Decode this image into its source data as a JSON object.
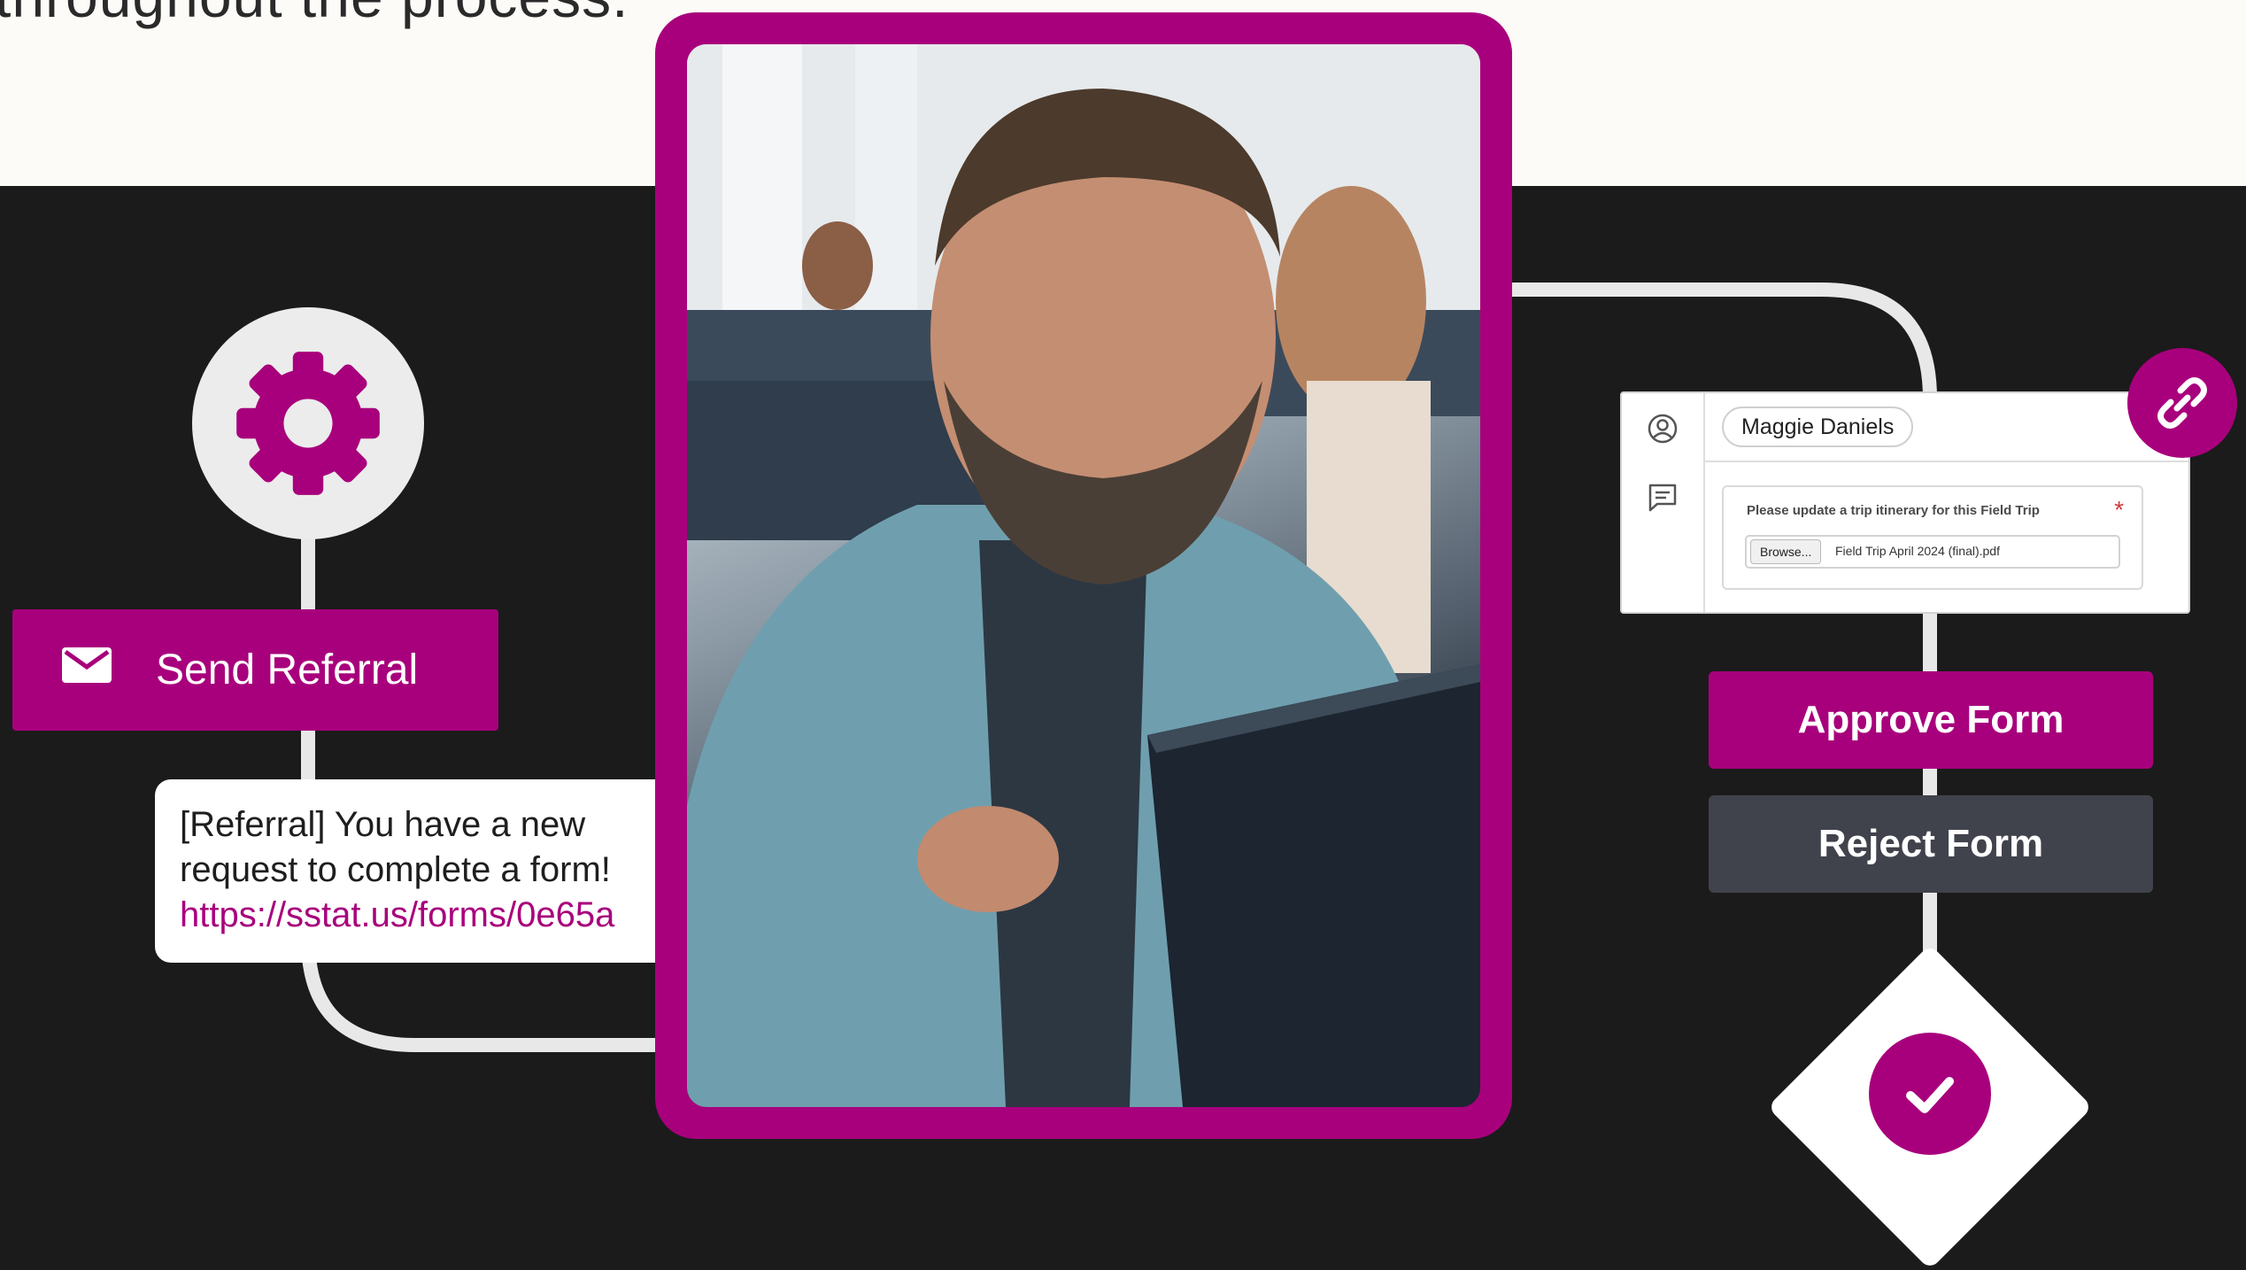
{
  "intro": {
    "text": "throughout the process."
  },
  "referral": {
    "send_label": "Send Referral",
    "message_line1": "[Referral] You have a new",
    "message_line2": "request to complete a form!",
    "message_link": "https://sstat.us/forms/0e65a"
  },
  "form": {
    "assignee": "Maggie Daniels",
    "question": "Please update a trip itinerary for this Field Trip",
    "required_mark": "*",
    "browse_label": "Browse...",
    "file_name": "Field Trip April 2024 (final).pdf"
  },
  "actions": {
    "approve_label": "Approve Form",
    "reject_label": "Reject Form"
  },
  "icons": [
    "gear-icon",
    "mail-icon",
    "user-icon",
    "comment-icon",
    "link-icon",
    "checkmark-icon"
  ],
  "colors": {
    "brand": "#a8007c",
    "background_dark": "#1b1b1b",
    "background_light": "#fcfbf8",
    "reject_button": "#40434b"
  }
}
